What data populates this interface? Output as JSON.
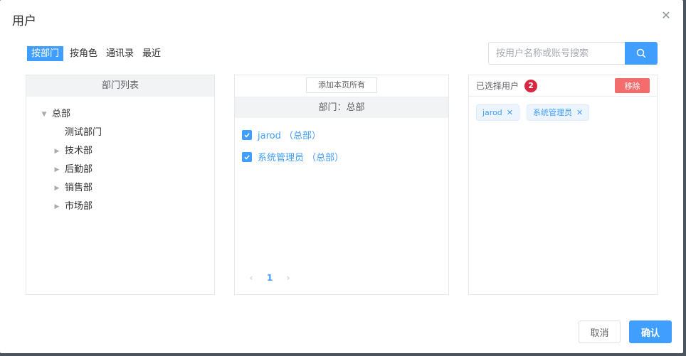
{
  "dialog": {
    "title": "用户"
  },
  "tabs": [
    {
      "label": "按部门",
      "active": true
    },
    {
      "label": "按角色",
      "active": false
    },
    {
      "label": "通讯录",
      "active": false
    },
    {
      "label": "最近",
      "active": false
    }
  ],
  "search": {
    "placeholder": "按用户名称或账号搜索",
    "value": ""
  },
  "dept_panel": {
    "header": "部门列表",
    "tree": [
      {
        "label": "总部",
        "level": 0,
        "caret": "down"
      },
      {
        "label": "测试部门",
        "level": 1,
        "caret": "none"
      },
      {
        "label": "技术部",
        "level": 1,
        "caret": "right"
      },
      {
        "label": "后勤部",
        "level": 1,
        "caret": "right"
      },
      {
        "label": "销售部",
        "level": 1,
        "caret": "right"
      },
      {
        "label": "市场部",
        "level": 1,
        "caret": "right"
      }
    ]
  },
  "user_panel": {
    "add_all_label": "添加本页所有",
    "dept_label": "部门：总部",
    "users": [
      {
        "label": "jarod （总部）",
        "checked": true
      },
      {
        "label": "系统管理员 （总部）",
        "checked": true
      }
    ],
    "pager": {
      "prev": "‹",
      "current": "1",
      "next": "›"
    }
  },
  "selected_panel": {
    "header": "已选择用户",
    "count": "2",
    "remove_label": "移除",
    "tags": [
      {
        "label": "jarod"
      },
      {
        "label": "系统管理员"
      }
    ]
  },
  "footer": {
    "cancel_label": "取消",
    "ok_label": "确认"
  },
  "colors": {
    "primary": "#409eff",
    "danger": "#f56c6c",
    "badge": "#d8283f"
  }
}
